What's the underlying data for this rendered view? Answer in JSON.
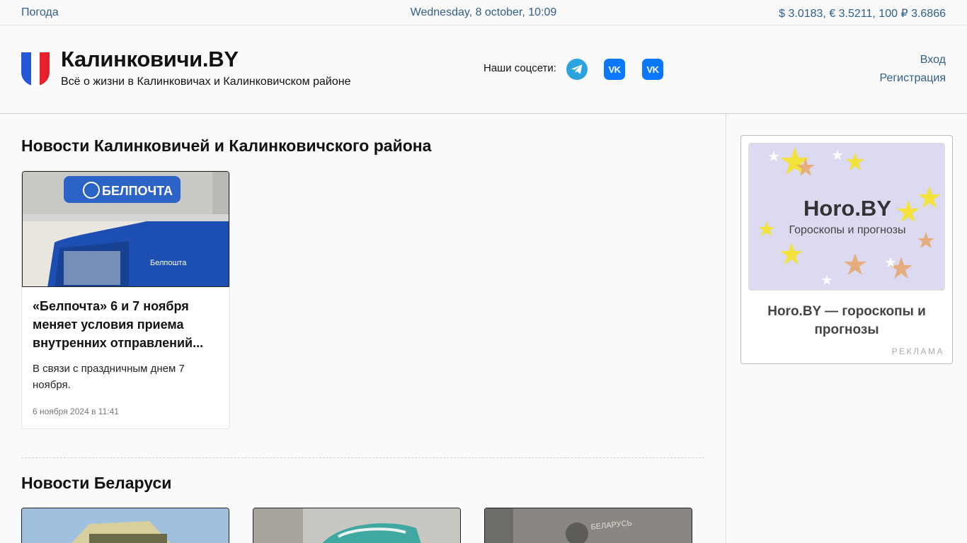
{
  "topbar": {
    "weather": "Погода",
    "date": "Wednesday, 8 october, 10:09",
    "rates": "$ 3.0183, € 3.5211, 100 ₽ 3.6866"
  },
  "header": {
    "title": "Калинковичи.BY",
    "tagline": "Всё о жизни в Калинковичах и Калинковичском районе",
    "social_label": "Наши соцсети:",
    "social_icons": [
      "telegram-icon",
      "vk-icon",
      "vk-icon"
    ],
    "login": "Вход",
    "register": "Регистрация"
  },
  "local_news": {
    "title": "Новости Калинковичей и Калинковичского района",
    "articles": [
      {
        "image_sign": "БЕЛПОЧТА",
        "image_van": "Белпошта",
        "title": "«Белпочта» 6 и 7 ноября меняет условия приема внутренних отправлений...",
        "desc": "В связи с праздничным днем 7 ноября.",
        "date": "6 ноября 2024 в 11:41"
      }
    ]
  },
  "belarus_news": {
    "title": "Новости Беларуси",
    "thumb_caption": "БЕЛАРУСЬ"
  },
  "ad": {
    "logo": "Horo.BY",
    "logo_sub": "Гороскопы и прогнозы",
    "title": "Horo.BY — гороскопы и прогнозы",
    "label": "РЕКЛАМА"
  },
  "colors": {
    "link": "#2f5f8c",
    "telegram": "#2aa3df",
    "vk": "#0a77ff"
  }
}
